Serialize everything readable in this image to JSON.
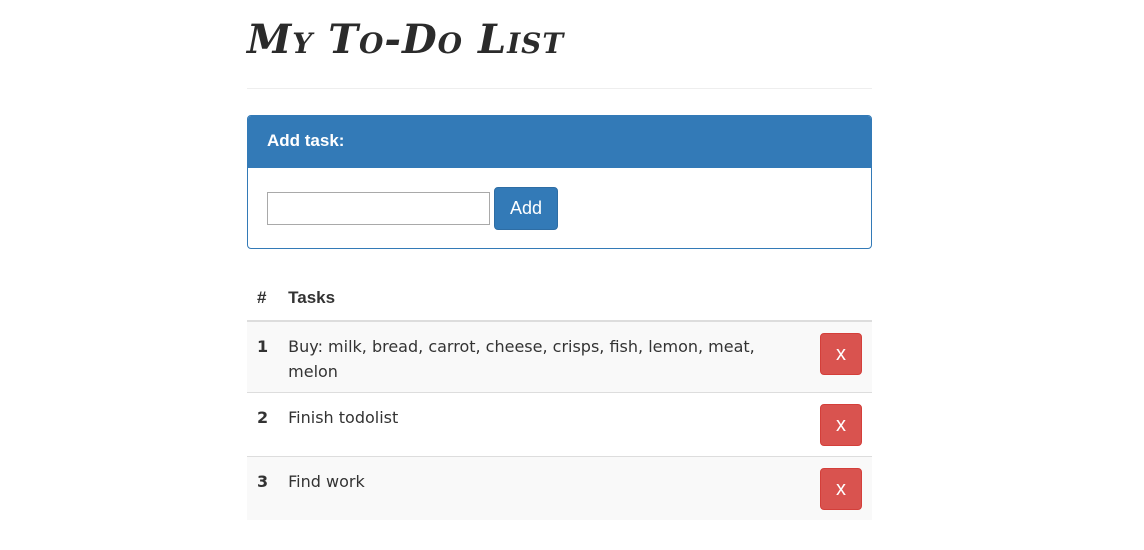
{
  "page": {
    "title": "My To-Do List"
  },
  "add_panel": {
    "heading": "Add task:",
    "input_value": "",
    "input_placeholder": "",
    "add_label": "Add"
  },
  "table": {
    "headers": [
      "#",
      "Tasks"
    ],
    "rows": [
      {
        "num": "1",
        "text": "Buy: milk, bread, carrot, cheese, crisps, fish, lemon, meat, melon",
        "delete_label": "x"
      },
      {
        "num": "2",
        "text": "Finish todolist",
        "delete_label": "x"
      },
      {
        "num": "3",
        "text": "Find work",
        "delete_label": "x"
      }
    ]
  },
  "colors": {
    "primary": "#337ab7",
    "danger": "#d9534f",
    "stripe": "#f9f9f9"
  }
}
